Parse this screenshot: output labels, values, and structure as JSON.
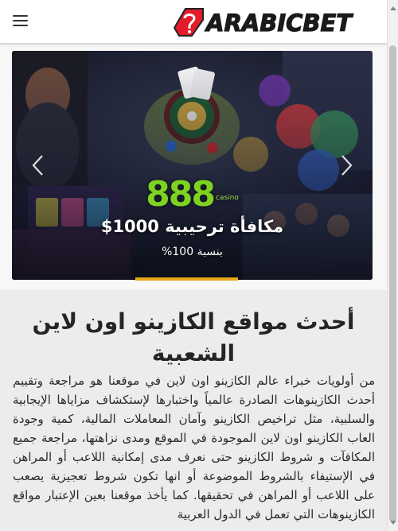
{
  "header": {
    "logo_text": "ARABICBET",
    "menu_icon": "hamburger-menu-icon"
  },
  "slider": {
    "brand_name": "888",
    "brand_suffix": "casino",
    "bonus_text": "مكافأة ترحيبية 1000$",
    "percent_text": "بنسبة 100%",
    "prev_icon": "chevron-left-icon",
    "next_icon": "chevron-right-icon",
    "colors": {
      "brand_green": "#7ed321",
      "indicator": "#e6a817",
      "logo_red": "#e21c2a"
    }
  },
  "article": {
    "title": "أحدث مواقع الكازينو اون لاين الشعبية",
    "body": "من أولويات خبراء عالم الكازينو اون لاين في موقعنا هو مراجعة وتقييم أحدث الكازينوهات الصادرة عالمياً واختبارها لإستكشاف مزاياها الإيجابية والسلبية، مثل تراخيص الكازينو وآمان المعاملات المالية، كمية وجودة العاب الكازينو اون لاين الموجودة في الموقع ومدى نزاهتها، مراجعة جميع المكافآت و شروط الكازينو  حتى نعرف مدى إمكانية اللاعب أو المراهن في الإستيفاء بالشروط الموضوعة أو انها تكون شروط تعجيزية يصعب على اللاعب أو المراهن في تحقيقها. كما يأخذ موقعنا بعين الإعتبار مواقع الكازينوهات التي تعمل في الدول العربية"
  }
}
